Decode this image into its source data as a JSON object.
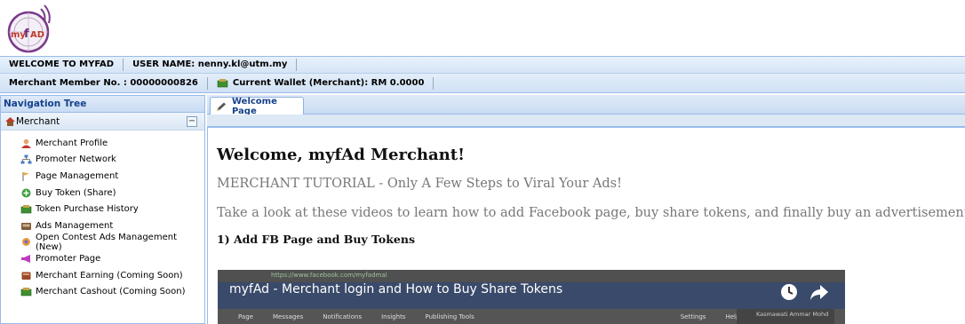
{
  "logo": {
    "text": "myfAD"
  },
  "header": {
    "welcome": "WELCOME TO MYFAD",
    "username": "USER NAME: nenny.kl@utm.my",
    "member_no": "Merchant Member No. : 00000000826",
    "wallet": "Current Wallet (Merchant): RM 0.0000"
  },
  "nav": {
    "title": "Navigation Tree",
    "section": "Merchant",
    "collapse_symbol": "−",
    "items": [
      {
        "label": "Merchant Profile",
        "icon": "user-icon"
      },
      {
        "label": "Promoter Network",
        "icon": "network-icon"
      },
      {
        "label": "Page Management",
        "icon": "flag-icon"
      },
      {
        "label": "Buy Token (Share)",
        "icon": "add-circle-icon"
      },
      {
        "label": "Token Purchase History",
        "icon": "money-icon"
      },
      {
        "label": "Ads Management",
        "icon": "ads-icon"
      },
      {
        "label": "Open Contest Ads Management (New)",
        "icon": "contest-icon"
      },
      {
        "label": "Promoter Page",
        "icon": "megaphone-icon"
      },
      {
        "label": "Merchant Earning (Coming Soon)",
        "icon": "earning-icon"
      },
      {
        "label": "Merchant Cashout (Coming Soon)",
        "icon": "cashout-icon"
      }
    ]
  },
  "tabs": [
    {
      "label": "Welcome Page",
      "icon": "pencil-icon"
    }
  ],
  "content": {
    "heading": "Welcome, myfAd Merchant!",
    "tutorial": "MERCHANT TUTORIAL - Only A Few Steps to Viral Your Ads!",
    "intro": "Take a look at these videos to learn how to add Facebook page, buy share tokens, and finally buy an advertisement.",
    "step1": "1) Add FB Page and Buy Tokens",
    "video": {
      "title": "myfAd - Merchant login and How to Buy Share Tokens",
      "url": "https://www.facebook.com/myfadmal",
      "fb_tabs": [
        "Page",
        "Messages",
        "Notifications",
        "Insights",
        "Publishing Tools"
      ],
      "fb_right": [
        "Settings",
        "Help"
      ],
      "profile_name": "Kasmawati Ammar Mohd"
    }
  },
  "colors": {
    "accent": "#15428b",
    "border": "#99bbe8",
    "video_bg": "#3b3b3b"
  }
}
